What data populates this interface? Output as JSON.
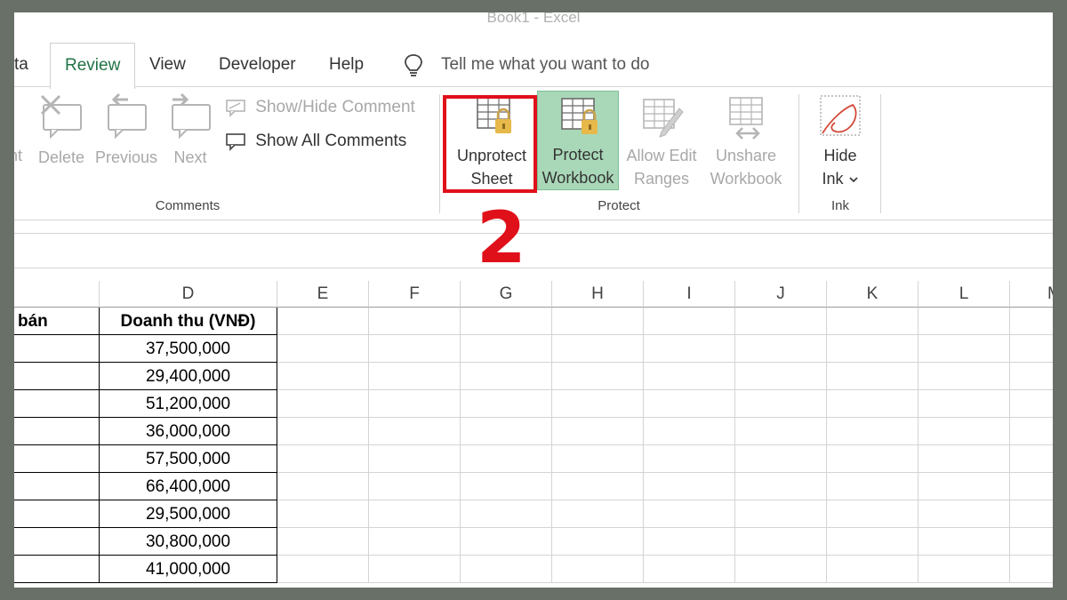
{
  "window": {
    "title": "Book1  -  Excel"
  },
  "tabs": [
    {
      "label": "ta",
      "active": false
    },
    {
      "label": "Review",
      "active": true
    },
    {
      "label": "View",
      "active": false
    },
    {
      "label": "Developer",
      "active": false
    },
    {
      "label": "Help",
      "active": false
    }
  ],
  "tell_me": {
    "placeholder": "Tell me what you want to do",
    "icon": "lightbulb-icon"
  },
  "ribbon": {
    "comments_group": {
      "label": "Comments",
      "partial_label": "nt",
      "delete": {
        "label": "Delete",
        "icon": "delete-comment-icon"
      },
      "previous": {
        "label": "Previous",
        "icon": "previous-comment-icon"
      },
      "next": {
        "label": "Next",
        "icon": "next-comment-icon"
      },
      "show_hide": {
        "label": "Show/Hide Comment",
        "icon": "show-hide-comment-icon"
      },
      "show_all": {
        "label": "Show All Comments",
        "icon": "show-all-comments-icon"
      }
    },
    "protect_group": {
      "label": "Protect",
      "unprotect_sheet": {
        "line1": "Unprotect",
        "line2": "Sheet",
        "icon": "unprotect-sheet-icon"
      },
      "protect_workbook": {
        "line1": "Protect",
        "line2": "Workbook",
        "icon": "protect-workbook-icon"
      },
      "allow_edit": {
        "line1": "Allow Edit",
        "line2": "Ranges",
        "icon": "allow-edit-ranges-icon"
      },
      "unshare": {
        "line1": "Unshare",
        "line2": "Workbook",
        "icon": "unshare-workbook-icon"
      }
    },
    "ink_group": {
      "label": "Ink",
      "hide_ink": {
        "line1": "Hide",
        "line2": "Ink",
        "icon": "hide-ink-icon"
      }
    }
  },
  "annotation": {
    "step": "2",
    "color": "#e0101a"
  },
  "sheet": {
    "columns": [
      "D",
      "E",
      "F",
      "G",
      "H",
      "I",
      "J",
      "K",
      "L",
      "M"
    ],
    "partial_header": "bán",
    "header": "Doanh thu (VNĐ)",
    "values": [
      "37,500,000",
      "29,400,000",
      "51,200,000",
      "36,000,000",
      "57,500,000",
      "66,400,000",
      "29,500,000",
      "30,800,000",
      "41,000,000"
    ]
  },
  "colors": {
    "accent": "#217346",
    "active_button_bg": "#a9d8b8",
    "frame": "#687068"
  }
}
